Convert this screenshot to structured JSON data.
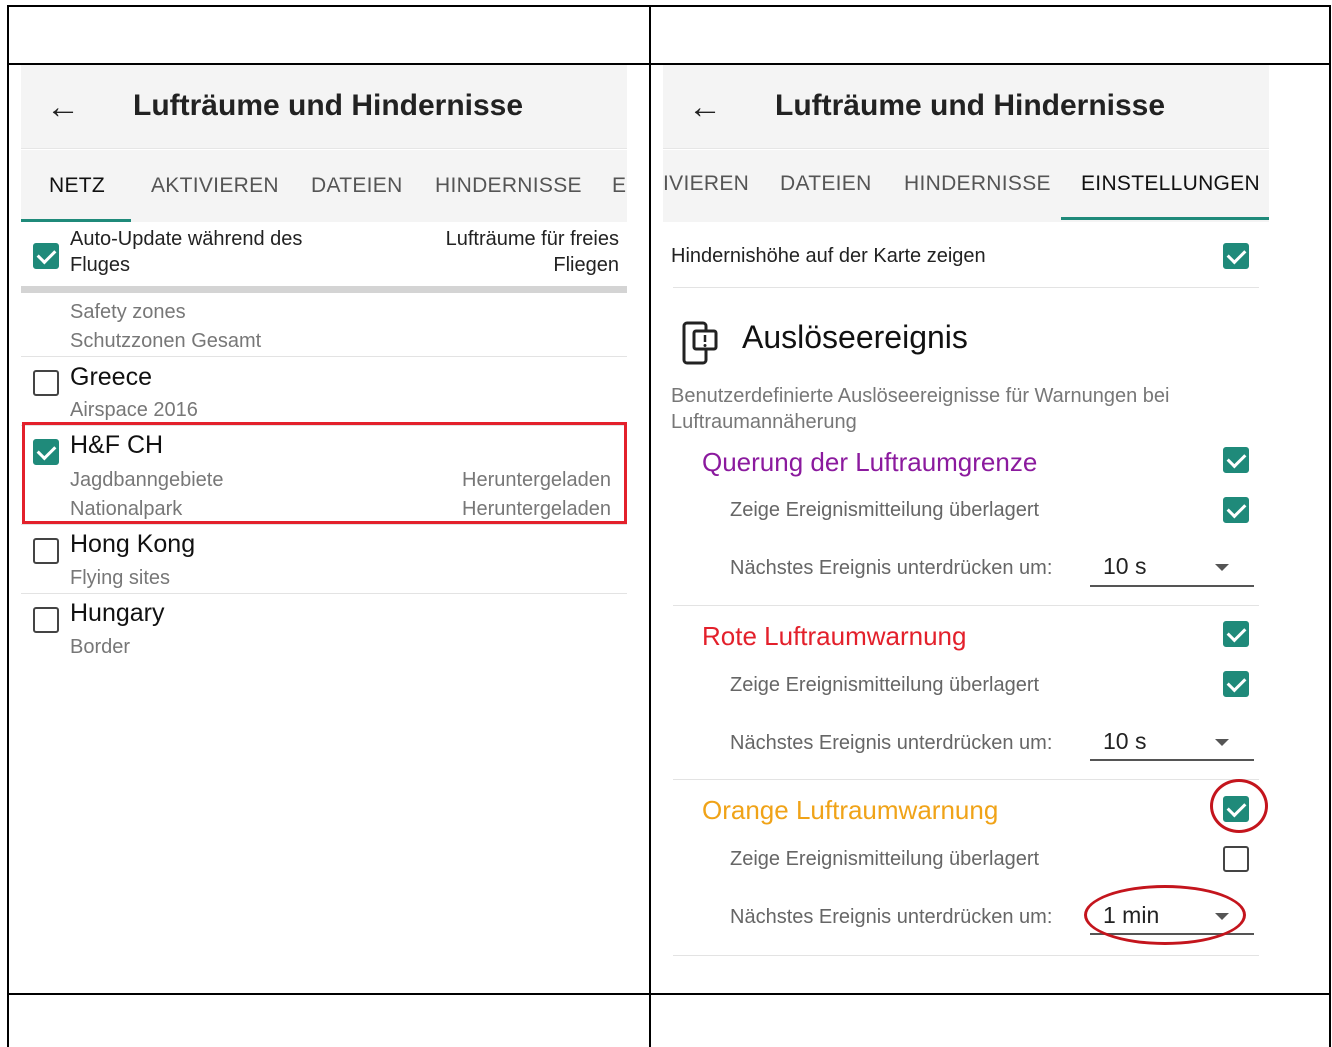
{
  "left": {
    "appbar": {
      "title": "Lufträume und Hindernisse"
    },
    "tabs": [
      "NETZ",
      "AKTIVIEREN",
      "DATEIEN",
      "HINDERNISSE",
      "EI"
    ],
    "header": {
      "auto_update_line1": "Auto-Update während des",
      "auto_update_line2": "Fluges",
      "right_line1": "Lufträume für freies",
      "right_line2": "Fliegen"
    },
    "safety": {
      "line1": "Safety zones",
      "line2": "Schutzzonen Gesamt"
    },
    "items": {
      "greece": {
        "title": "Greece",
        "sub": "Airspace 2016"
      },
      "hfch": {
        "title": "H&F CH",
        "sub1": "Jagdbanngebiete",
        "status1": "Heruntergeladen",
        "sub2": "Nationalpark",
        "status2": "Heruntergeladen"
      },
      "hongkong": {
        "title": "Hong Kong",
        "sub": "Flying sites"
      },
      "hungary": {
        "title": "Hungary",
        "sub": "Border"
      }
    }
  },
  "right": {
    "appbar": {
      "title": "Lufträume und Hindernisse"
    },
    "tabs": [
      "IVIEREN",
      "DATEIEN",
      "HINDERNISSE",
      "EINSTELLUNGEN"
    ],
    "obstacle_height": "Hindernishöhe auf der Karte zeigen",
    "section": {
      "title": "Auslöseereignis",
      "description_line1": "Benutzerdefinierte Auslöseereignisse für Warnungen bei",
      "description_line2": "Luftraumannäherung"
    },
    "groups": {
      "crossing": {
        "title": "Querung der Luftraumgrenze",
        "overlay": "Zeige Ereignismitteilung überlagert",
        "suppress": "Nächstes Ereignis unterdrücken um:",
        "value": "10 s"
      },
      "red": {
        "title": "Rote Luftraumwarnung",
        "overlay": "Zeige Ereignismitteilung überlagert",
        "suppress": "Nächstes Ereignis unterdrücken um:",
        "value": "10 s"
      },
      "orange": {
        "title": "Orange Luftraumwarnung",
        "overlay": "Zeige Ereignismitteilung überlagert",
        "suppress": "Nächstes Ereignis unterdrücken um:",
        "value": "1 min"
      }
    }
  },
  "colors": {
    "accent": "#1f8a7a",
    "purple": "#8b1a9e",
    "red": "#e3202b",
    "orange": "#f0a318"
  }
}
